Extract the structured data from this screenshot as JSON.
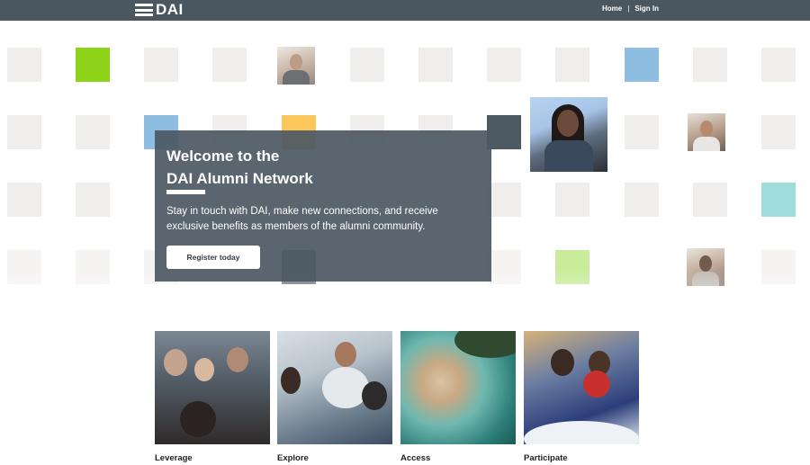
{
  "header": {
    "logo_text": "DAI",
    "nav": [
      {
        "label": "Home"
      },
      {
        "label": "Sign In"
      }
    ],
    "nav_separator": "|"
  },
  "hero": {
    "title_line1": "Welcome to the",
    "title_line2": "DAI Alumni Network",
    "body": "Stay in touch with DAI, make new connections, and receive exclusive benefits as members of the alumni community.",
    "cta_label": "Register today"
  },
  "features": [
    {
      "label": "Leverage"
    },
    {
      "label": "Explore"
    },
    {
      "label": "Access"
    },
    {
      "label": "Participate"
    }
  ],
  "colors": {
    "header_bg": "#4a5660",
    "hero_card_bg": "#4c5863",
    "tile_green": "#8fd21a",
    "tile_blue": "#8dbde0",
    "tile_orange": "#fbc75a",
    "tile_teal": "#9fdcdc"
  }
}
